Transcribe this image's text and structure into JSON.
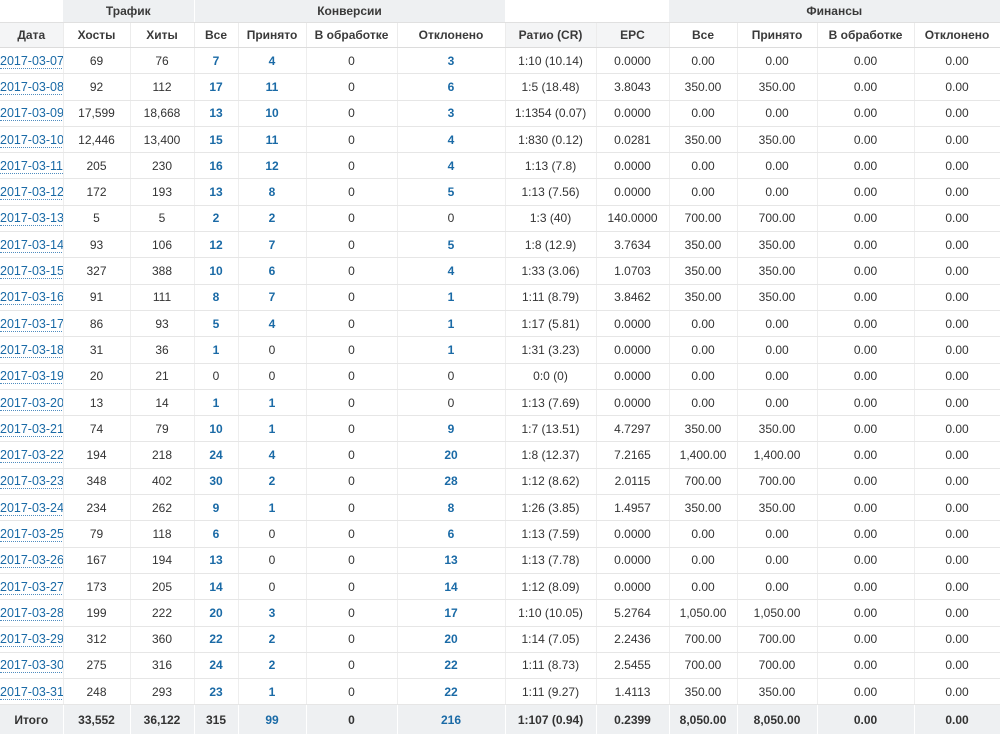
{
  "groups": {
    "traffic": "Трафик",
    "conversions": "Конверсии",
    "finance": "Финансы"
  },
  "headers": [
    "Дата",
    "Хосты",
    "Хиты",
    "Все",
    "Принято",
    "В обработке",
    "Отклонено",
    "Ратио (CR)",
    "EPC",
    "Все",
    "Принято",
    "В обработке",
    "Отклонено"
  ],
  "rows": [
    [
      "2017-03-07",
      "69",
      "76",
      "7",
      "4",
      "0",
      "3",
      "1:10 (10.14)",
      "0.0000",
      "0.00",
      "0.00",
      "0.00",
      "0.00"
    ],
    [
      "2017-03-08",
      "92",
      "112",
      "17",
      "11",
      "0",
      "6",
      "1:5 (18.48)",
      "3.8043",
      "350.00",
      "350.00",
      "0.00",
      "0.00"
    ],
    [
      "2017-03-09",
      "17,599",
      "18,668",
      "13",
      "10",
      "0",
      "3",
      "1:1354 (0.07)",
      "0.0000",
      "0.00",
      "0.00",
      "0.00",
      "0.00"
    ],
    [
      "2017-03-10",
      "12,446",
      "13,400",
      "15",
      "11",
      "0",
      "4",
      "1:830 (0.12)",
      "0.0281",
      "350.00",
      "350.00",
      "0.00",
      "0.00"
    ],
    [
      "2017-03-11",
      "205",
      "230",
      "16",
      "12",
      "0",
      "4",
      "1:13 (7.8)",
      "0.0000",
      "0.00",
      "0.00",
      "0.00",
      "0.00"
    ],
    [
      "2017-03-12",
      "172",
      "193",
      "13",
      "8",
      "0",
      "5",
      "1:13 (7.56)",
      "0.0000",
      "0.00",
      "0.00",
      "0.00",
      "0.00"
    ],
    [
      "2017-03-13",
      "5",
      "5",
      "2",
      "2",
      "0",
      "0",
      "1:3 (40)",
      "140.0000",
      "700.00",
      "700.00",
      "0.00",
      "0.00"
    ],
    [
      "2017-03-14",
      "93",
      "106",
      "12",
      "7",
      "0",
      "5",
      "1:8 (12.9)",
      "3.7634",
      "350.00",
      "350.00",
      "0.00",
      "0.00"
    ],
    [
      "2017-03-15",
      "327",
      "388",
      "10",
      "6",
      "0",
      "4",
      "1:33 (3.06)",
      "1.0703",
      "350.00",
      "350.00",
      "0.00",
      "0.00"
    ],
    [
      "2017-03-16",
      "91",
      "111",
      "8",
      "7",
      "0",
      "1",
      "1:11 (8.79)",
      "3.8462",
      "350.00",
      "350.00",
      "0.00",
      "0.00"
    ],
    [
      "2017-03-17",
      "86",
      "93",
      "5",
      "4",
      "0",
      "1",
      "1:17 (5.81)",
      "0.0000",
      "0.00",
      "0.00",
      "0.00",
      "0.00"
    ],
    [
      "2017-03-18",
      "31",
      "36",
      "1",
      "0",
      "0",
      "1",
      "1:31 (3.23)",
      "0.0000",
      "0.00",
      "0.00",
      "0.00",
      "0.00"
    ],
    [
      "2017-03-19",
      "20",
      "21",
      "0",
      "0",
      "0",
      "0",
      "0:0 (0)",
      "0.0000",
      "0.00",
      "0.00",
      "0.00",
      "0.00"
    ],
    [
      "2017-03-20",
      "13",
      "14",
      "1",
      "1",
      "0",
      "0",
      "1:13 (7.69)",
      "0.0000",
      "0.00",
      "0.00",
      "0.00",
      "0.00"
    ],
    [
      "2017-03-21",
      "74",
      "79",
      "10",
      "1",
      "0",
      "9",
      "1:7 (13.51)",
      "4.7297",
      "350.00",
      "350.00",
      "0.00",
      "0.00"
    ],
    [
      "2017-03-22",
      "194",
      "218",
      "24",
      "4",
      "0",
      "20",
      "1:8 (12.37)",
      "7.2165",
      "1,400.00",
      "1,400.00",
      "0.00",
      "0.00"
    ],
    [
      "2017-03-23",
      "348",
      "402",
      "30",
      "2",
      "0",
      "28",
      "1:12 (8.62)",
      "2.0115",
      "700.00",
      "700.00",
      "0.00",
      "0.00"
    ],
    [
      "2017-03-24",
      "234",
      "262",
      "9",
      "1",
      "0",
      "8",
      "1:26 (3.85)",
      "1.4957",
      "350.00",
      "350.00",
      "0.00",
      "0.00"
    ],
    [
      "2017-03-25",
      "79",
      "118",
      "6",
      "0",
      "0",
      "6",
      "1:13 (7.59)",
      "0.0000",
      "0.00",
      "0.00",
      "0.00",
      "0.00"
    ],
    [
      "2017-03-26",
      "167",
      "194",
      "13",
      "0",
      "0",
      "13",
      "1:13 (7.78)",
      "0.0000",
      "0.00",
      "0.00",
      "0.00",
      "0.00"
    ],
    [
      "2017-03-27",
      "173",
      "205",
      "14",
      "0",
      "0",
      "14",
      "1:12 (8.09)",
      "0.0000",
      "0.00",
      "0.00",
      "0.00",
      "0.00"
    ],
    [
      "2017-03-28",
      "199",
      "222",
      "20",
      "3",
      "0",
      "17",
      "1:10 (10.05)",
      "5.2764",
      "1,050.00",
      "1,050.00",
      "0.00",
      "0.00"
    ],
    [
      "2017-03-29",
      "312",
      "360",
      "22",
      "2",
      "0",
      "20",
      "1:14 (7.05)",
      "2.2436",
      "700.00",
      "700.00",
      "0.00",
      "0.00"
    ],
    [
      "2017-03-30",
      "275",
      "316",
      "24",
      "2",
      "0",
      "22",
      "1:11 (8.73)",
      "2.5455",
      "700.00",
      "700.00",
      "0.00",
      "0.00"
    ],
    [
      "2017-03-31",
      "248",
      "293",
      "23",
      "1",
      "0",
      "22",
      "1:11 (9.27)",
      "1.4113",
      "350.00",
      "350.00",
      "0.00",
      "0.00"
    ]
  ],
  "totals": [
    "Итого",
    "33,552",
    "36,122",
    "315",
    "99",
    "0",
    "216",
    "1:107 (0.94)",
    "0.2399",
    "8,050.00",
    "8,050.00",
    "0.00",
    "0.00"
  ],
  "colors": {
    "link": "#1a6aa6",
    "header_bg": "#eef0f2"
  }
}
